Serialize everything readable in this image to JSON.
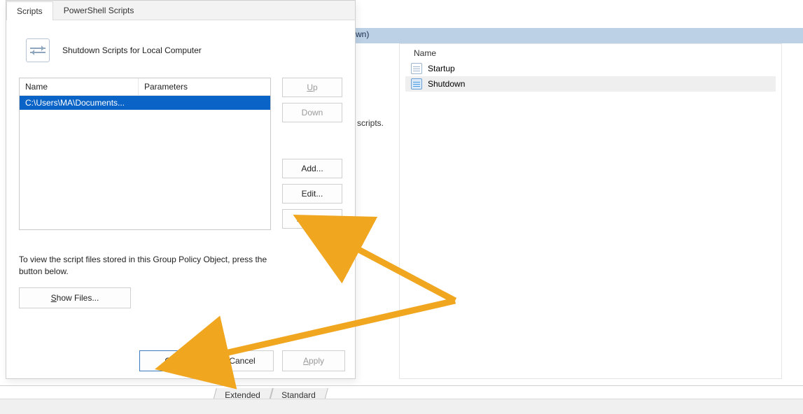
{
  "background": {
    "titlebar_fragment": "wn)",
    "column_header": "Name",
    "items": [
      {
        "label": "Startup"
      },
      {
        "label": "Shutdown"
      }
    ],
    "hint_fragment": "n scripts.",
    "tabs": {
      "extended": "Extended",
      "standard": "Standard"
    }
  },
  "dialog": {
    "tabs": {
      "scripts": "Scripts",
      "powershell": "PowerShell Scripts"
    },
    "title": "Shutdown Scripts for Local Computer",
    "list": {
      "headers": {
        "name": "Name",
        "parameters": "Parameters"
      },
      "rows": [
        {
          "name": "C:\\Users\\MA\\Documents...",
          "parameters": ""
        }
      ]
    },
    "buttons": {
      "up": "Up",
      "down": "Down",
      "add": "Add...",
      "edit": "Edit...",
      "remove": "Remove",
      "show_files": "Show Files...",
      "ok": "OK",
      "cancel": "Cancel",
      "apply": "Apply"
    },
    "help": "To view the script files stored in this Group Policy Object, press the button below."
  },
  "annotation": {
    "color": "#f0a61f"
  }
}
